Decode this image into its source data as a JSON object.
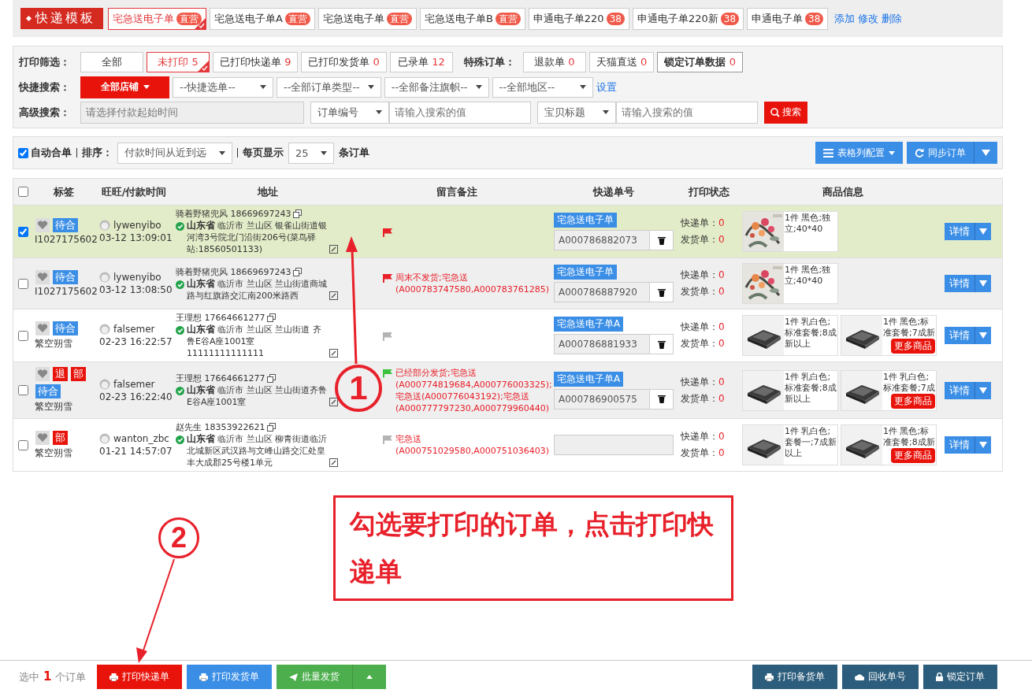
{
  "header": {
    "logo": "快递模板",
    "templates": [
      {
        "label": "宅急送电子单",
        "badge": "直营",
        "selected": true
      },
      {
        "label": "宅急送电子单A",
        "badge": "直营",
        "selected": false
      },
      {
        "label": "宅急送电子单",
        "badge": "直营",
        "selected": false
      },
      {
        "label": "宅急送电子单B",
        "badge": "直营",
        "selected": false
      },
      {
        "label": "申通电子单220",
        "badge": "38",
        "selected": false
      },
      {
        "label": "申通电子单220新",
        "badge": "38",
        "selected": false
      },
      {
        "label": "申通电子单",
        "badge": "38",
        "selected": false
      }
    ],
    "links": [
      "添加",
      "修改",
      "删除"
    ]
  },
  "filters": {
    "print_label": "打印筛选：",
    "print_filters": [
      {
        "label": "全部",
        "selected": false
      },
      {
        "label": "未打印",
        "count": "5",
        "selected": true
      },
      {
        "label": "已打印快递单",
        "count": "9",
        "selected": false
      },
      {
        "label": "已打印发货单",
        "count": "0",
        "selected": false
      },
      {
        "label": "已录单",
        "count": "12",
        "selected": false
      }
    ],
    "special_label": "特殊订单：",
    "special_filters": [
      {
        "label": "退款单",
        "count": "0",
        "bold": false
      },
      {
        "label": "天猫直送",
        "count": "0",
        "bold": false
      },
      {
        "label": "锁定订单数据",
        "count": "0",
        "bold": true
      }
    ],
    "quick_label": "快捷搜索：",
    "shop_button": "全部店铺",
    "quick_selects": [
      "--快捷选单--",
      "--全部订单类型--",
      "--全部备注旗帜--",
      "--全部地区--"
    ],
    "settings_link": "设置",
    "advanced_label": "高级搜索：",
    "date_placeholder": "请选择付款起始时间",
    "search_groups": [
      {
        "field": "订单编号",
        "placeholder": "请输入搜索的值"
      },
      {
        "field": "宝贝标题",
        "placeholder": "请输入搜索的值"
      }
    ],
    "search_button": "搜索"
  },
  "toolbar": {
    "auto_merge": {
      "label": "自动合单",
      "checked": true
    },
    "sort_label": "排序：",
    "sort": "付款时间从近到远",
    "page_label": "每页显示",
    "page_size": "25",
    "page_suffix": "条订单",
    "columns_button": "表格列配置",
    "sync_button": "同步订单"
  },
  "table": {
    "all_checked": false,
    "columns": [
      "标签",
      "旺旺/付款时间",
      "地址",
      "留言备注",
      "快递单号",
      "打印状态",
      "商品信息"
    ],
    "rows": [
      {
        "selected": true,
        "tags": [
          {
            "text": "待合",
            "color": "#3a8ee6"
          }
        ],
        "buyer": "I1027175602",
        "wangwang": "lywenyibo",
        "time": "03-12 13:09:01",
        "contact": "骑着野猪兜风 18669697243",
        "address": "**山东省** 临沂市 兰山区 银雀山街道银河湾3号院北门沿街206号(菜鸟驿站:18560501133)",
        "flag": {
          "color": "#e8202a"
        },
        "template": "宅急送电子单",
        "tracking": "A000786882073",
        "status": [
          {
            "label": "快递单：",
            "value": "0"
          },
          {
            "label": "发货单：",
            "value": "0"
          }
        ],
        "products": [
          "1件 黑色;独立;40*40"
        ],
        "detail": "详情"
      },
      {
        "selected": false,
        "tags": [
          {
            "text": "待合",
            "color": "#3a8ee6"
          }
        ],
        "buyer": "I1027175602",
        "wangwang": "lywenyibo",
        "time": "03-12 13:08:50",
        "contact": "骑着野猪兜风 18669697243",
        "address": "**山东省** 临沂市 兰山区 兰山街道商城路与红旗路交汇南200米路西",
        "flag": {
          "color": "#e8202a"
        },
        "remark": "周末不发货;宅急送(A000783747580,A000783761285)",
        "template": "宅急送电子单",
        "tracking": "A000786887920",
        "status": [
          {
            "label": "快递单：",
            "value": "0"
          },
          {
            "label": "发货单：",
            "value": "0"
          }
        ],
        "products": [
          "1件 黑色;独立;40*40"
        ],
        "detail": "详情"
      },
      {
        "selected": false,
        "tags": [
          {
            "text": "待合",
            "color": "#3a8ee6"
          }
        ],
        "buyer": "繁空朔雪",
        "wangwang": "falsemer",
        "time": "02-23 16:22:57",
        "contact": "王理想 17664661277",
        "address": "**山东省** 临沂市 兰山区 兰山街道 齐鲁E谷A座1001室11111111111111",
        "flag": {
          "color": "#b4b4b4"
        },
        "template": "宅急送电子单A",
        "tracking": "A000786881933",
        "status": [
          {
            "label": "快递单：",
            "value": "0"
          },
          {
            "label": "发货单：",
            "value": "0"
          }
        ],
        "products": [
          "1件 乳白色;标准套餐;8成新以上",
          "1件 黑色;标准套餐;7成新"
        ],
        "more": "更多商品",
        "detail": "详情"
      },
      {
        "selected": false,
        "tags": [
          {
            "text": "退",
            "color": "#e8140c"
          },
          {
            "text": "部",
            "color": "#e8140c"
          },
          {
            "text": "待合",
            "color": "#3a8ee6"
          }
        ],
        "buyer": "繁空朔雪",
        "wangwang": "falsemer",
        "time": "02-23 16:22:40",
        "contact": "王理想 17664661277",
        "address": "**山东省** 临沂市 兰山区 兰山街道齐鲁E谷A座1001室",
        "flag": {
          "color": "#3cc13c"
        },
        "remark": "已经部分发货;宅急送(A000774819684,A000776003325);宅急送(A000776043192);宅急送(A000777797230,A000779960440)",
        "template": "宅急送电子单A",
        "tracking": "A000786900575",
        "status": [
          {
            "label": "快递单：",
            "value": "0"
          },
          {
            "label": "发货单：",
            "value": "0"
          }
        ],
        "products": [
          "1件 乳白色;标准套餐;8成新以上",
          "1件 乳白色;标准套餐;7成"
        ],
        "more": "更多商品",
        "detail": "详情"
      },
      {
        "selected": false,
        "tags": [
          {
            "text": "部",
            "color": "#e8140c"
          }
        ],
        "buyer": "繁空朔雪",
        "wangwang": "wanton_zbc",
        "time": "01-21 14:57:07",
        "contact": "赵先生 18353922621",
        "address": "**山东省** 临沂市 兰山区 柳青街道临沂北城新区武汉路与文峰山路交汇处皇丰大成郡25号楼1单元",
        "flag": {
          "color": "#b4b4b4"
        },
        "remark": "宅急送(A000751029580,A000751036403)",
        "status": [
          {
            "label": "快递单：",
            "value": "0"
          },
          {
            "label": "发货单：",
            "value": "0"
          }
        ],
        "products": [
          "1件 乳白色;套餐一;7成新以上",
          "1件 黑色;标准套餐;8成新"
        ],
        "more": "更多商品",
        "detail": "详情"
      }
    ]
  },
  "footer": {
    "selected_prefix": "选中",
    "selected_count": "1",
    "selected_suffix": "个订单",
    "left_buttons": [
      {
        "label": "打印快递单",
        "kind": "print",
        "color": "#e8140c"
      },
      {
        "label": "打印发货单",
        "kind": "print",
        "color": "#3a8ee6"
      },
      {
        "label": "批量发货",
        "kind": "ship",
        "color": "#4cae4c",
        "menu": true
      }
    ],
    "right_buttons": [
      {
        "label": "打印备货单",
        "kind": "print",
        "color": "#2c5d7c"
      },
      {
        "label": "回收单号",
        "kind": "recycle",
        "color": "#2c5d7c"
      },
      {
        "label": "锁定订单",
        "kind": "lock",
        "color": "#2c5d7c"
      }
    ]
  },
  "annotations": {
    "steps": [
      "1",
      "2"
    ],
    "callout": "勾选要打印的订单，点击打印快递单"
  }
}
